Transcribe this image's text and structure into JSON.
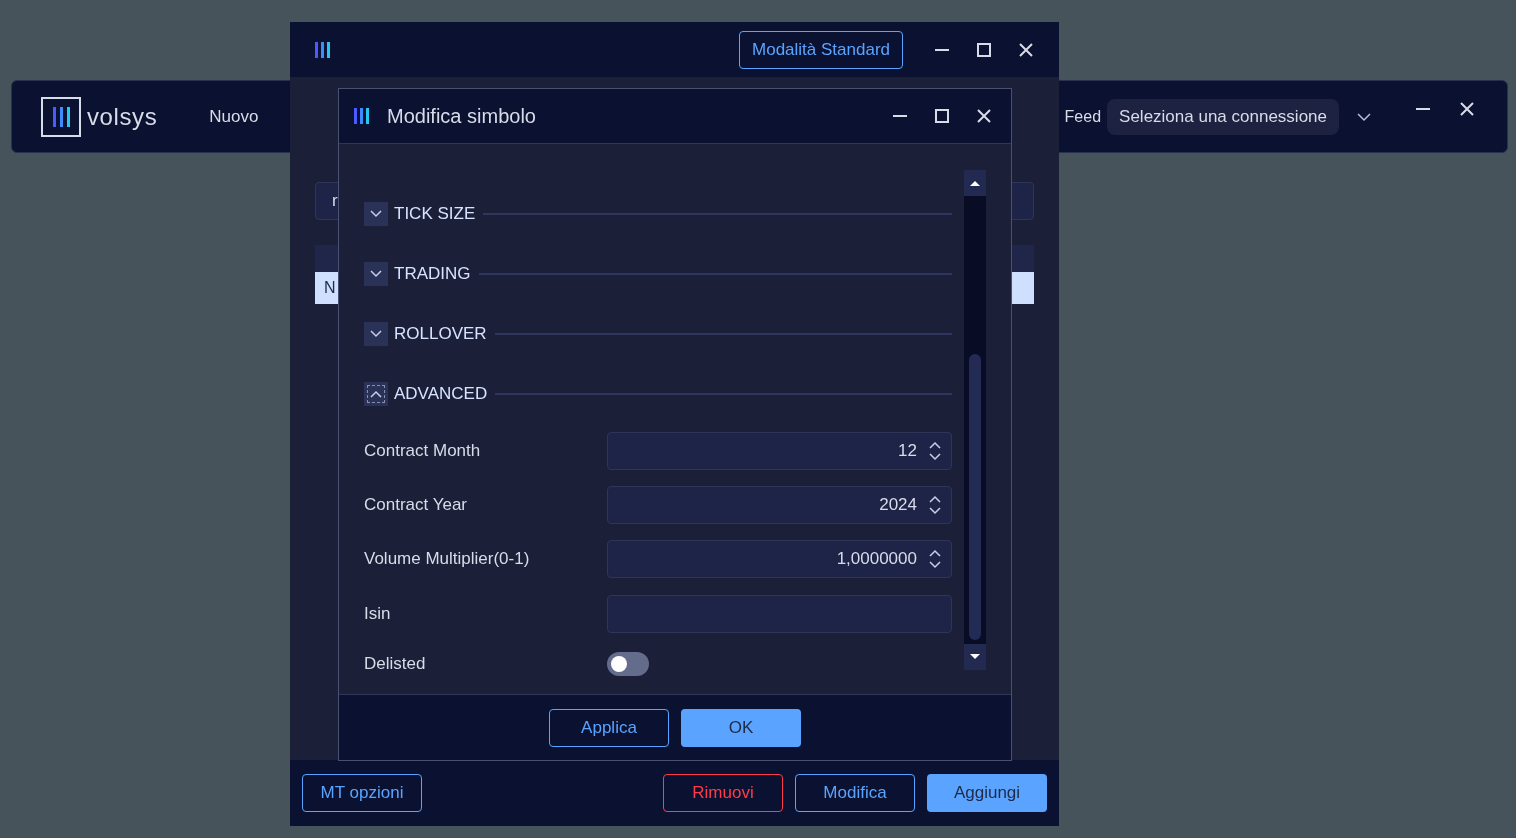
{
  "app_bar": {
    "logo_text": "volsys",
    "menu": [
      {
        "label": "Nuovo"
      }
    ],
    "feed_label": "Feed",
    "connection": {
      "value": "Seleziona una connessione"
    }
  },
  "symbols_window": {
    "mode_button": "Modalità Standard",
    "search_value": "r",
    "rows": [
      {
        "text": "N",
        "selected": true
      }
    ],
    "buttons": [
      {
        "label": "MT opzioni",
        "kind": "outline"
      },
      {
        "label": "Rimuovi",
        "kind": "danger"
      },
      {
        "label": "Modifica",
        "kind": "outline"
      },
      {
        "label": "Aggiungi",
        "kind": "primary"
      }
    ]
  },
  "dialog": {
    "title": "Modifica simbolo",
    "sections": [
      {
        "label": "TICK SIZE",
        "expanded": false
      },
      {
        "label": "TRADING",
        "expanded": false
      },
      {
        "label": "ROLLOVER",
        "expanded": false
      },
      {
        "label": "ADVANCED",
        "expanded": true
      }
    ],
    "fields": [
      {
        "kind": "spin",
        "label": "Contract Month",
        "value": "12"
      },
      {
        "kind": "spin",
        "label": "Contract Year",
        "value": "2024"
      },
      {
        "kind": "spin",
        "label": "Volume Multiplier(0-1)",
        "value": "1,0000000"
      },
      {
        "kind": "text",
        "label": "Isin"
      },
      {
        "kind": "toggle",
        "label": "Delisted",
        "on": false
      }
    ],
    "buttons": [
      {
        "label": "Applica",
        "kind": "outline"
      },
      {
        "label": "OK",
        "kind": "primary"
      }
    ]
  }
}
